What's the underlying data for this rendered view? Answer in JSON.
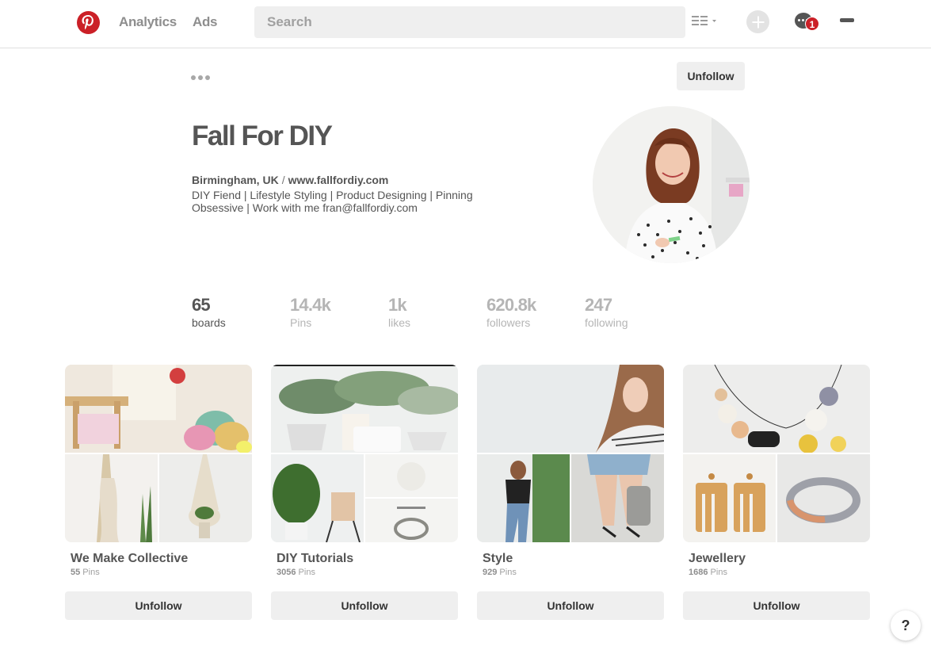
{
  "header": {
    "nav": [
      {
        "label": "Analytics"
      },
      {
        "label": "Ads"
      }
    ],
    "search_placeholder": "Search",
    "notification_count": "1",
    "colors": {
      "brand": "#cb2027"
    }
  },
  "profile": {
    "unfollow_label": "Unfollow",
    "name": "Fall For DIY",
    "location": "Birmingham, UK",
    "location_separator": "/",
    "website": "www.fallfordiy.com",
    "bio": "DIY Fiend | Lifestyle Styling | Product Designing | Pinning Obsessive | Work with me fran@fallfordiy.com"
  },
  "stats": [
    {
      "value": "65",
      "label": "boards"
    },
    {
      "value": "14.4k",
      "label": "Pins"
    },
    {
      "value": "1k",
      "label": "likes"
    },
    {
      "value": "620.8k",
      "label": "followers"
    },
    {
      "value": "247",
      "label": "following"
    }
  ],
  "boards": [
    {
      "title": "We Make Collective",
      "count": "55",
      "count_suffix": " Pins",
      "button": "Unfollow"
    },
    {
      "title": "DIY Tutorials",
      "count": "3056",
      "count_suffix": " Pins",
      "button": "Unfollow"
    },
    {
      "title": "Style",
      "count": "929",
      "count_suffix": " Pins",
      "button": "Unfollow"
    },
    {
      "title": "Jewellery",
      "count": "1686",
      "count_suffix": " Pins",
      "button": "Unfollow"
    }
  ],
  "help_label": "?"
}
